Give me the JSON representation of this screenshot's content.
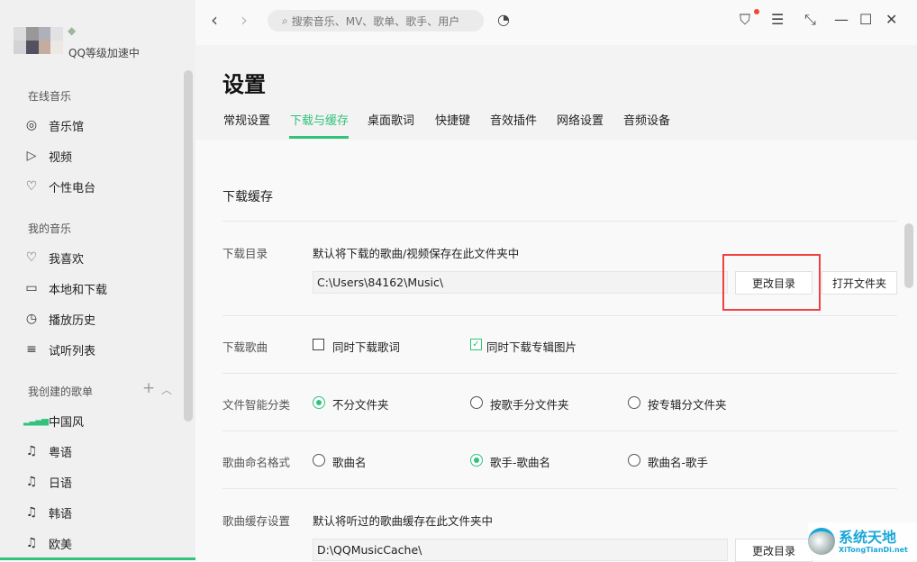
{
  "sidebar": {
    "user_status": "QQ等级加速中",
    "sections": [
      {
        "title": "在线音乐",
        "items": [
          {
            "label": "音乐馆",
            "icon": "music-hall-icon"
          },
          {
            "label": "视频",
            "icon": "video-icon"
          },
          {
            "label": "个性电台",
            "icon": "radio-heart-icon"
          }
        ]
      },
      {
        "title": "我的音乐",
        "items": [
          {
            "label": "我喜欢",
            "icon": "heart-icon"
          },
          {
            "label": "本地和下载",
            "icon": "monitor-icon"
          },
          {
            "label": "播放历史",
            "icon": "clock-icon"
          },
          {
            "label": "试听列表",
            "icon": "playlist-icon"
          }
        ]
      },
      {
        "title": "我创建的歌单",
        "items": [
          {
            "label": "中国风",
            "icon": "playing-bars-icon"
          },
          {
            "label": "粤语",
            "icon": "music-note-icon"
          },
          {
            "label": "日语",
            "icon": "music-note-icon"
          },
          {
            "label": "韩语",
            "icon": "music-note-icon"
          },
          {
            "label": "欧美",
            "icon": "music-note-icon"
          }
        ]
      }
    ]
  },
  "topbar": {
    "search_placeholder": "搜索音乐、MV、歌单、歌手、用户"
  },
  "page": {
    "title": "设置",
    "tabs": [
      "常规设置",
      "下载与缓存",
      "桌面歌词",
      "快捷键",
      "音效插件",
      "网络设置",
      "音频设备"
    ],
    "active_tab": "下载与缓存"
  },
  "section_title": "下载缓存",
  "download_dir": {
    "label": "下载目录",
    "desc": "默认将下载的歌曲/视频保存在此文件夹中",
    "path": "C:\\Users\\84162\\Music\\",
    "change_btn": "更改目录",
    "open_btn": "打开文件夹"
  },
  "download_songs": {
    "label": "下载歌曲",
    "options": [
      {
        "label": "同时下载歌词",
        "checked": false
      },
      {
        "label": "同时下载专辑图片",
        "checked": true
      }
    ]
  },
  "smart_classify": {
    "label": "文件智能分类",
    "options": [
      "不分文件夹",
      "按歌手分文件夹",
      "按专辑分文件夹"
    ],
    "selected": 0
  },
  "naming": {
    "label": "歌曲命名格式",
    "options": [
      "歌曲名",
      "歌手-歌曲名",
      "歌曲名-歌手"
    ],
    "selected": 1
  },
  "cache": {
    "label": "歌曲缓存设置",
    "desc": "默认将听过的歌曲缓存在此文件夹中",
    "path": "D:\\QQMusicCache\\",
    "change_btn": "更改目录"
  },
  "watermark": {
    "name": "系统天地",
    "url": "XiTongTianDi.net"
  },
  "colors": {
    "accent": "#31c27c",
    "highlight": "#f04040"
  }
}
